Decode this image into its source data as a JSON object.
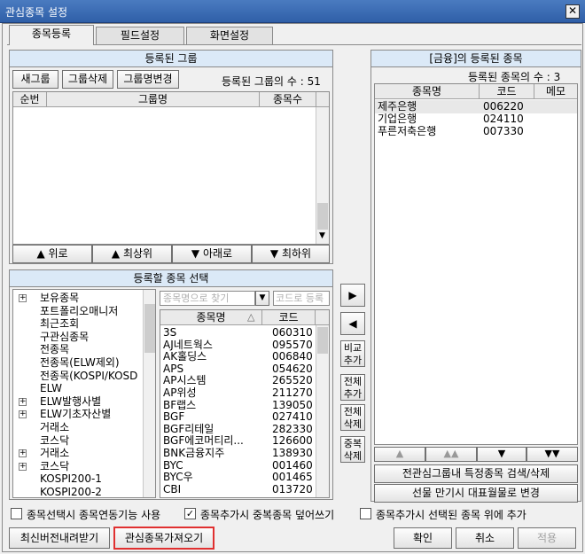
{
  "window": {
    "title": "관심종목 설정",
    "close": "✕"
  },
  "tabs": [
    "종목등록",
    "필드설정",
    "화면설정"
  ],
  "groups": {
    "header": "등록된 그룹",
    "buttons": [
      "새그룹",
      "그룹삭제",
      "그룹명변경"
    ],
    "count_label": "등록된 그룹의 수 : 51",
    "columns": [
      "순번",
      "그룹명",
      "종목수"
    ],
    "move_buttons": [
      "▲ 위로",
      "▲ 최상위",
      "▼ 아래로",
      "▼ 최하위"
    ]
  },
  "select": {
    "header": "등록할 종목 선택",
    "tree": [
      "보유종목",
      "포트폴리오매니저",
      "최근조회",
      "구관심종목",
      "전종목",
      "전종목(ELW제외)",
      "전종목(KOSPI/KOSD",
      "ELW",
      "ELW발행사별",
      "ELW기초자산별",
      "거래소",
      "코스닥",
      "거래소",
      "코스닥",
      "KOSPI200-1",
      "KOSPI200-2"
    ],
    "search_placeholder": "종목명으로 찾기",
    "code_placeholder": "코드로 등록",
    "columns": [
      "종목명",
      "코드"
    ],
    "sort_icon": "△",
    "stocks": [
      {
        "name": "3S",
        "code": "060310"
      },
      {
        "name": "AJ네트웍스",
        "code": "095570"
      },
      {
        "name": "AK홀딩스",
        "code": "006840"
      },
      {
        "name": "APS",
        "code": "054620"
      },
      {
        "name": "AP시스템",
        "code": "265520"
      },
      {
        "name": "AP위성",
        "code": "211270"
      },
      {
        "name": "BF랩스",
        "code": "139050"
      },
      {
        "name": "BGF",
        "code": "027410"
      },
      {
        "name": "BGF리테일",
        "code": "282330"
      },
      {
        "name": "BGF에코머티리...",
        "code": "126600"
      },
      {
        "name": "BNK금융지주",
        "code": "138930"
      },
      {
        "name": "BYC",
        "code": "001460"
      },
      {
        "name": "BYC우",
        "code": "001465"
      },
      {
        "name": "CBI",
        "code": "013720"
      }
    ]
  },
  "middle_buttons": {
    "add": "▶",
    "remove": "◀",
    "compare_add": "비교추가",
    "add_all": "전체추가",
    "delete_all": "전체삭제",
    "delete_dup": "중복삭제"
  },
  "registered": {
    "header": "[금융]의 등록된 종목",
    "count_label": "등록된 종목의 수 : 3",
    "columns": [
      "종목명",
      "코드",
      "메모"
    ],
    "items": [
      {
        "name": "제주은행",
        "code": "006220"
      },
      {
        "name": "기업은행",
        "code": "024110"
      },
      {
        "name": "푸른저축은행",
        "code": "007330"
      }
    ],
    "move_buttons": [
      "▲",
      "▲▲",
      "▼",
      "▼▼"
    ],
    "search_button": "전관심그룹내 특정종목 검색/삭제",
    "change_button": "선물 만기시 대표월물로 변경"
  },
  "options": [
    {
      "label": "종목선택시 종목연동기능 사용",
      "checked": false
    },
    {
      "label": "종목추가시 중복종목 덮어쓰기",
      "checked": true
    },
    {
      "label": "종목추가시 선택된 종목 위에 추가",
      "checked": false
    }
  ],
  "footer": {
    "download": "최신버전내려받기",
    "import": "관심종목가져오기",
    "ok": "확인",
    "cancel": "취소",
    "apply": "적용"
  },
  "highlight_color": "#e03030",
  "selected_row_color": "#e8e8e8"
}
